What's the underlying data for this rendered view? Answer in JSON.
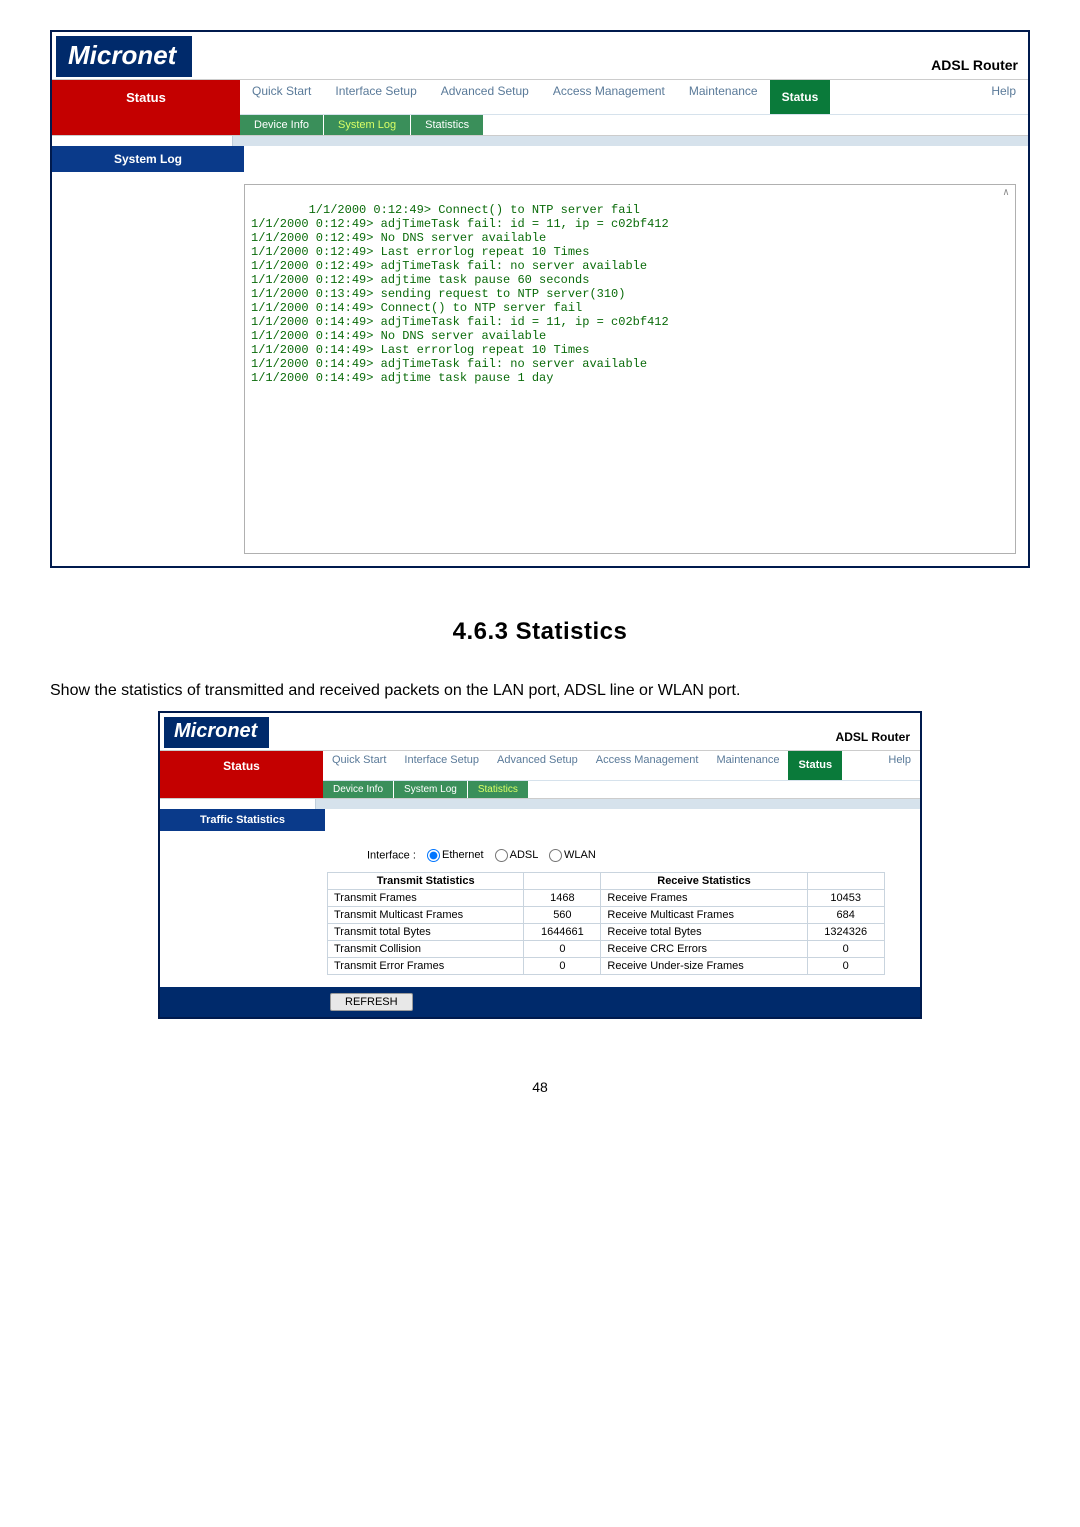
{
  "brand": "Micronet",
  "router_label": "ADSL Router",
  "nav": {
    "status": "Status",
    "quick_start": "Quick Start",
    "interface_setup": "Interface Setup",
    "advanced_setup": "Advanced Setup",
    "access_mgmt": "Access Management",
    "maintenance": "Maintenance",
    "status_green": "Status",
    "help": "Help"
  },
  "subnav": {
    "device_info": "Device Info",
    "system_log": "System Log",
    "statistics": "Statistics"
  },
  "syslog": {
    "panel_title": "System Log",
    "lines": "1/1/2000 0:12:49> Connect() to NTP server fail\n1/1/2000 0:12:49> adjTimeTask fail: id = 11, ip = c02bf412\n1/1/2000 0:12:49> No DNS server available\n1/1/2000 0:12:49> Last errorlog repeat 10 Times\n1/1/2000 0:12:49> adjTimeTask fail: no server available\n1/1/2000 0:12:49> adjtime task pause 60 seconds\n1/1/2000 0:13:49> sending request to NTP server(310)\n1/1/2000 0:14:49> Connect() to NTP server fail\n1/1/2000 0:14:49> adjTimeTask fail: id = 11, ip = c02bf412\n1/1/2000 0:14:49> No DNS server available\n1/1/2000 0:14:49> Last errorlog repeat 10 Times\n1/1/2000 0:14:49> adjTimeTask fail: no server available\n1/1/2000 0:14:49> adjtime task pause 1 day"
  },
  "section": {
    "heading": "4.6.3  Statistics",
    "para": "Show the statistics of transmitted and received packets on the LAN port, ADSL line or WLAN port."
  },
  "traffic": {
    "panel_title": "Traffic Statistics",
    "iface_label": "Interface :",
    "iface_eth": "Ethernet",
    "iface_adsl": "ADSL",
    "iface_wlan": "WLAN",
    "tx_header": "Transmit Statistics",
    "rx_header": "Receive Statistics",
    "rows": [
      {
        "tx_name": "Transmit Frames",
        "tx_val": "1468",
        "rx_name": "Receive Frames",
        "rx_val": "10453"
      },
      {
        "tx_name": "Transmit Multicast Frames",
        "tx_val": "560",
        "rx_name": "Receive Multicast Frames",
        "rx_val": "684"
      },
      {
        "tx_name": "Transmit total Bytes",
        "tx_val": "1644661",
        "rx_name": "Receive total Bytes",
        "rx_val": "1324326"
      },
      {
        "tx_name": "Transmit Collision",
        "tx_val": "0",
        "rx_name": "Receive CRC Errors",
        "rx_val": "0"
      },
      {
        "tx_name": "Transmit Error Frames",
        "tx_val": "0",
        "rx_name": "Receive Under-size Frames",
        "rx_val": "0"
      }
    ],
    "refresh": "REFRESH"
  },
  "page_number": "48"
}
